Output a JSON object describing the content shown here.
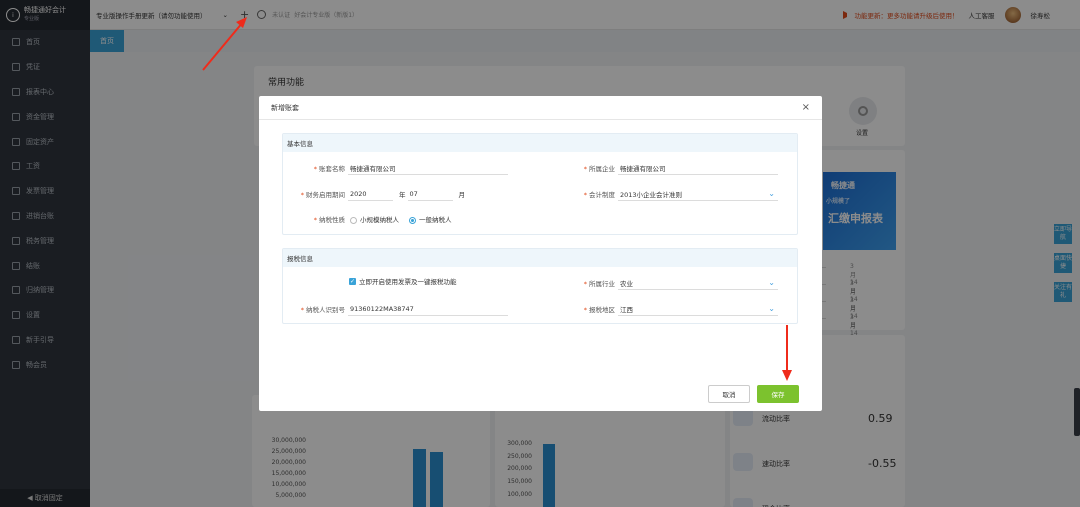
{
  "app": {
    "logo_text": "畅捷通好会计",
    "logo_sub": "专业版"
  },
  "sidebar": {
    "items": [
      {
        "label": "首页",
        "icon": "home-icon"
      },
      {
        "label": "凭证",
        "icon": "voucher-icon"
      },
      {
        "label": "报表中心",
        "icon": "report-icon"
      },
      {
        "label": "资金管理",
        "icon": "fund-icon"
      },
      {
        "label": "固定资产",
        "icon": "asset-icon"
      },
      {
        "label": "工资",
        "icon": "salary-icon"
      },
      {
        "label": "发票管理",
        "icon": "invoice-icon"
      },
      {
        "label": "进销台账",
        "icon": "ledger-icon"
      },
      {
        "label": "税务管理",
        "icon": "tax-icon"
      },
      {
        "label": "结账",
        "icon": "close-account-icon"
      },
      {
        "label": "归纳管理",
        "icon": "archive-icon"
      },
      {
        "label": "设置",
        "icon": "settings-icon"
      },
      {
        "label": "新手引导",
        "icon": "guide-icon"
      },
      {
        "label": "畅会员",
        "icon": "vip-icon"
      }
    ],
    "footer": "◀ 取消固定"
  },
  "topbar": {
    "account_select": "专业版操作手册更新（请勿功能使用）",
    "add_glyph": "+",
    "status_tag": "未认证",
    "account_type": "好会计专业版（新版1）",
    "notice": "功能更新：更多功能请升级后使用！",
    "support": "人工客服",
    "user": "徐寿松"
  },
  "tabs": {
    "home": "首页"
  },
  "dashboard": {
    "common_title": "常用功能",
    "settings_label": "设置",
    "banner": {
      "line1": "畅捷通",
      "line2": "小规模了",
      "line3": "汇缴申报表"
    },
    "news": [
      {
        "text": "…",
        "date": "3月14日"
      },
      {
        "text": "…",
        "date": "3月14日"
      },
      {
        "text": "…",
        "date": "3月14日"
      },
      {
        "text": "…",
        "date": "3月14日"
      }
    ],
    "ratios": [
      {
        "label": "流动比率",
        "value": "0.59"
      },
      {
        "label": "速动比率",
        "value": "-0.55"
      },
      {
        "label": "现金比率",
        "value": ""
      }
    ],
    "floating": [
      {
        "label": "立即导航"
      },
      {
        "label": "桌面快捷"
      },
      {
        "label": "关注有礼"
      }
    ]
  },
  "chart_data": [
    {
      "type": "bar",
      "yticks": [
        "30,000,000",
        "25,000,000",
        "20,000,000",
        "15,000,000",
        "10,000,000",
        "5,000,000"
      ],
      "ylim": [
        0,
        30000000
      ],
      "series": [
        {
          "values": [
            26500000,
            25200000
          ]
        }
      ]
    },
    {
      "type": "bar",
      "yticks": [
        "300,000",
        "250,000",
        "200,000",
        "150,000",
        "100,000"
      ],
      "ylim": [
        0,
        300000
      ],
      "series": [
        {
          "values": [
            300000
          ]
        }
      ]
    }
  ],
  "modal": {
    "title": "新增账套",
    "basic": {
      "title": "基本信息",
      "name_label": "账套名称",
      "name_value": "畅捷通有限公司",
      "company_label": "所属企业",
      "company_value": "畅捷通有限公司",
      "period_label": "财务启用期间",
      "year_value": "2020",
      "year_unit": "年",
      "month_value": "07",
      "month_unit": "月",
      "standard_label": "会计制度",
      "standard_value": "2013小企业会计准则",
      "taxpayer_label": "纳税性质",
      "taxpayer_small": "小规模纳税人",
      "taxpayer_general": "一般纳税人"
    },
    "tax": {
      "title": "报税信息",
      "enable_label": "立即开启使用发票及一键报税功能",
      "industry_label": "所属行业",
      "industry_value": "农业",
      "taxid_label": "纳税人识别号",
      "taxid_value": "91360122MA38747",
      "region_label": "报税地区",
      "region_value": "江西"
    },
    "cancel": "取消",
    "save": "保存"
  }
}
